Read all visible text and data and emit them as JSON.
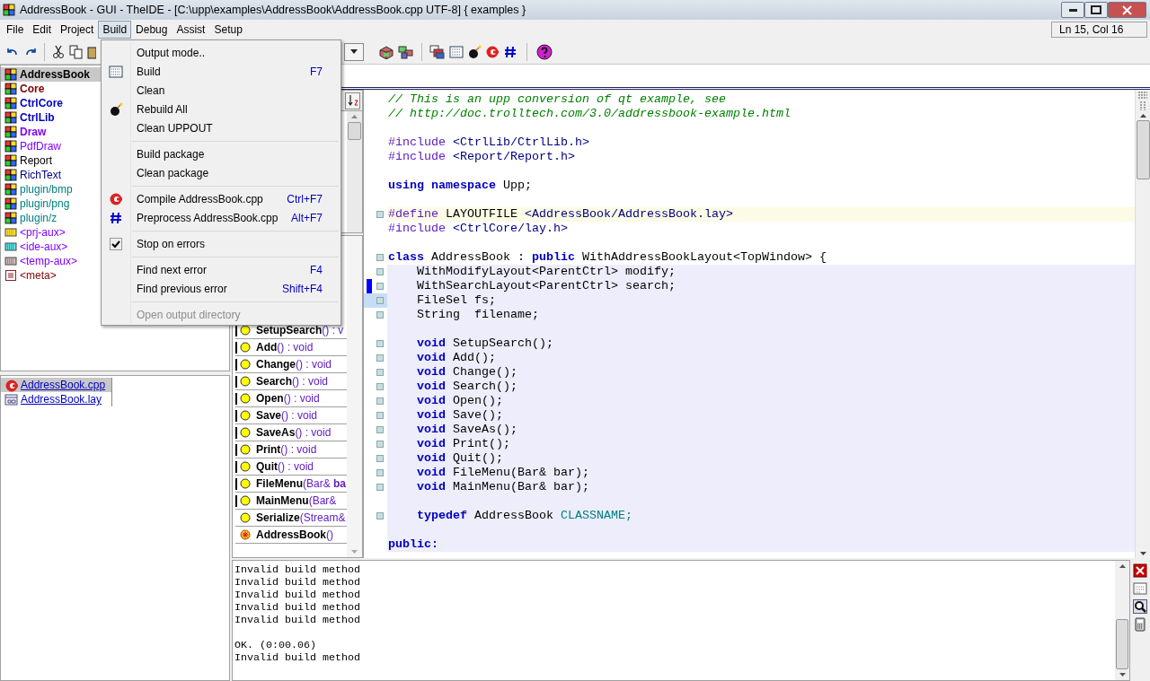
{
  "window": {
    "title": "AddressBook - GUI - TheIDE - [C:\\upp\\examples\\AddressBook\\AddressBook.cpp UTF-8] { examples }"
  },
  "menu_bar": [
    {
      "label": "File",
      "selected": false
    },
    {
      "label": "Edit",
      "selected": false
    },
    {
      "label": "Project",
      "selected": false
    },
    {
      "label": "Build",
      "selected": true
    },
    {
      "label": "Debug",
      "selected": false
    },
    {
      "label": "Assist",
      "selected": false
    },
    {
      "label": "Setup",
      "selected": false
    }
  ],
  "position": "Ln 15, Col 16",
  "build_menu": [
    {
      "kind": "item",
      "label": "Output mode..",
      "disabled": false
    },
    {
      "kind": "item",
      "label": "Build",
      "shortcut": "F7",
      "disabled": false
    },
    {
      "kind": "item",
      "label": "Clean",
      "disabled": false
    },
    {
      "kind": "item",
      "label": "Rebuild All",
      "disabled": false
    },
    {
      "kind": "item",
      "label": "Clean UPPOUT",
      "disabled": false
    },
    {
      "kind": "separator"
    },
    {
      "kind": "item",
      "label": "Build package",
      "disabled": false
    },
    {
      "kind": "item",
      "label": "Clean package",
      "disabled": false
    },
    {
      "kind": "separator"
    },
    {
      "kind": "item",
      "label": "Compile AddressBook.cpp",
      "shortcut": "Ctrl+F7",
      "disabled": false
    },
    {
      "kind": "item",
      "label": "Preprocess AddressBook.cpp",
      "shortcut": "Alt+F7",
      "disabled": false
    },
    {
      "kind": "separator"
    },
    {
      "kind": "item",
      "label": "Stop on errors",
      "checked": true,
      "disabled": false
    },
    {
      "kind": "separator"
    },
    {
      "kind": "item",
      "label": "Find next error",
      "shortcut": "F4",
      "disabled": false
    },
    {
      "kind": "item",
      "label": "Find previous error",
      "shortcut": "Shift+F4",
      "disabled": false
    },
    {
      "kind": "separator"
    },
    {
      "kind": "item",
      "label": "Open output directory",
      "disabled": true
    }
  ],
  "packages": [
    {
      "name": "AddressBook",
      "kind": "package",
      "color": "#000000",
      "bold": true,
      "selected": true
    },
    {
      "name": "Core",
      "kind": "package",
      "color": "#800000",
      "bold": true,
      "selected": false
    },
    {
      "name": "CtrlCore",
      "kind": "package",
      "color": "#0000c0",
      "bold": true,
      "selected": false
    },
    {
      "name": "CtrlLib",
      "kind": "package",
      "color": "#0000c0",
      "bold": true,
      "selected": false
    },
    {
      "name": "Draw",
      "kind": "package",
      "color": "#8000ff",
      "bold": true,
      "selected": false
    },
    {
      "name": "PdfDraw",
      "kind": "package",
      "color": "#8000ff",
      "bold": false,
      "selected": false
    },
    {
      "name": "Report",
      "kind": "package",
      "color": "#000000",
      "bold": false,
      "selected": false
    },
    {
      "name": "RichText",
      "kind": "package",
      "color": "#000080",
      "bold": false,
      "selected": false
    },
    {
      "name": "plugin/bmp",
      "kind": "package",
      "color": "#008080",
      "bold": false,
      "selected": false
    },
    {
      "name": "plugin/png",
      "kind": "package",
      "color": "#008080",
      "bold": false,
      "selected": false
    },
    {
      "name": "plugin/z",
      "kind": "package",
      "color": "#008080",
      "bold": false,
      "selected": false
    },
    {
      "name": "<prj-aux>",
      "kind": "aux-yellow",
      "color": "#8000ff",
      "bold": false,
      "selected": false
    },
    {
      "name": "<ide-aux>",
      "kind": "aux-cyan",
      "color": "#8000ff",
      "bold": false,
      "selected": false
    },
    {
      "name": "<temp-aux>",
      "kind": "aux-gray",
      "color": "#8000ff",
      "bold": false,
      "selected": false
    },
    {
      "name": "<meta>",
      "kind": "meta",
      "color": "#800000",
      "bold": false,
      "selected": false
    }
  ],
  "files": [
    {
      "name": "AddressBook.cpp",
      "kind": "cpp",
      "selected": true
    },
    {
      "name": "AddressBook.lay",
      "kind": "layout",
      "selected": false
    }
  ],
  "navigator": [
    {
      "name": "SetupSearch",
      "rest": "() : v",
      "marked": true,
      "kind": "method"
    },
    {
      "name": "Add",
      "rest": "() : void",
      "marked": true,
      "kind": "method"
    },
    {
      "name": "Change",
      "rest": "() : void",
      "marked": true,
      "kind": "method"
    },
    {
      "name": "Search",
      "rest": "() : void",
      "marked": true,
      "kind": "method"
    },
    {
      "name": "Open",
      "rest": "() : void",
      "marked": true,
      "kind": "method"
    },
    {
      "name": "Save",
      "rest": "() : void",
      "marked": true,
      "kind": "method"
    },
    {
      "name": "SaveAs",
      "rest": "() : void",
      "marked": true,
      "kind": "method"
    },
    {
      "name": "Print",
      "rest": "() : void",
      "marked": true,
      "kind": "method"
    },
    {
      "name": "Quit",
      "rest": "() : void",
      "marked": true,
      "kind": "method"
    },
    {
      "name": "FileMenu",
      "rest": "(Bar& **ba**",
      "marked": true,
      "kind": "method"
    },
    {
      "name": "MainMenu",
      "rest": "(Bar&",
      "marked": true,
      "kind": "method"
    },
    {
      "name": "Serialize",
      "rest": "(Stream&",
      "marked": false,
      "kind": "method"
    },
    {
      "name": "AddressBook",
      "rest": "()",
      "marked": false,
      "kind": "constructor"
    }
  ],
  "code": [
    {
      "kind": "code",
      "tokens": [
        {
          "kind": "comment",
          "text": "// This is an upp conversion of qt example, see"
        }
      ]
    },
    {
      "kind": "code",
      "tokens": [
        {
          "kind": "comment",
          "text": "// http://doc.trolltech.com/3.0/addressbook-example.html"
        }
      ]
    },
    {
      "kind": "blank"
    },
    {
      "kind": "code",
      "tokens": [
        {
          "kind": "preproc",
          "text": "#include"
        },
        {
          "kind": "header",
          "text": "<CtrlLib/CtrlLib.h>"
        }
      ]
    },
    {
      "kind": "code",
      "tokens": [
        {
          "kind": "preproc",
          "text": "#include"
        },
        {
          "kind": "header",
          "text": "<Report/Report.h>"
        }
      ]
    },
    {
      "kind": "blank"
    },
    {
      "kind": "code",
      "tokens": [
        {
          "kind": "keyword",
          "text": "using namespace"
        },
        {
          "kind": "plain",
          "text": "Upp;"
        }
      ]
    },
    {
      "kind": "blank"
    },
    {
      "kind": "code",
      "tokens": [
        {
          "kind": "preproc",
          "text": "#define"
        },
        {
          "kind": "plain",
          "text": "LAYOUTFILE"
        },
        {
          "kind": "header",
          "text": "<AddressBook/AddressBook.lay>"
        }
      ],
      "marker": true,
      "highlighted": true
    },
    {
      "kind": "code",
      "tokens": [
        {
          "kind": "preproc",
          "text": "#include"
        },
        {
          "kind": "header",
          "text": "<CtrlCore/lay.h>"
        }
      ]
    },
    {
      "kind": "blank"
    },
    {
      "kind": "code",
      "tokens": [
        {
          "kind": "keyword",
          "text": "class"
        },
        {
          "kind": "plain",
          "text": "AddressBook :"
        },
        {
          "kind": "keyword",
          "text": "public"
        },
        {
          "kind": "plain",
          "text": "WithAddressBookLayout<TopWindow> {"
        }
      ],
      "marker": true
    },
    {
      "kind": "code",
      "indent": true,
      "tokens": [
        {
          "kind": "plain",
          "text": "WithModifyLayout<ParentCtrl> modify;"
        }
      ],
      "marker": true,
      "shaded": true
    },
    {
      "kind": "code",
      "indent": true,
      "tokens": [
        {
          "kind": "plain",
          "text": "WithSearchLayout<ParentCtrl> search;"
        }
      ],
      "marker": true,
      "changed": true,
      "shaded": true
    },
    {
      "kind": "code",
      "indent": true,
      "tokens": [
        {
          "kind": "plain",
          "text": "FileSel fs;"
        }
      ],
      "marker": true,
      "current": true,
      "shaded": true
    },
    {
      "kind": "code",
      "indent": true,
      "tokens": [
        {
          "kind": "plain",
          "text": "String  filename;"
        }
      ],
      "marker": true,
      "shaded": true
    },
    {
      "kind": "blank",
      "shaded": true
    },
    {
      "kind": "code",
      "indent": true,
      "tokens": [
        {
          "kind": "keyword",
          "text": "void"
        },
        {
          "kind": "plain",
          "text": "SetupSearch();"
        }
      ],
      "marker": true,
      "shaded": true
    },
    {
      "kind": "code",
      "indent": true,
      "tokens": [
        {
          "kind": "keyword",
          "text": "void"
        },
        {
          "kind": "plain",
          "text": "Add();"
        }
      ],
      "marker": true,
      "shaded": true
    },
    {
      "kind": "code",
      "indent": true,
      "tokens": [
        {
          "kind": "keyword",
          "text": "void"
        },
        {
          "kind": "plain",
          "text": "Change();"
        }
      ],
      "marker": true,
      "shaded": true
    },
    {
      "kind": "code",
      "indent": true,
      "tokens": [
        {
          "kind": "keyword",
          "text": "void"
        },
        {
          "kind": "plain",
          "text": "Search();"
        }
      ],
      "marker": true,
      "shaded": true
    },
    {
      "kind": "code",
      "indent": true,
      "tokens": [
        {
          "kind": "keyword",
          "text": "void"
        },
        {
          "kind": "plain",
          "text": "Open();"
        }
      ],
      "marker": true,
      "shaded": true
    },
    {
      "kind": "code",
      "indent": true,
      "tokens": [
        {
          "kind": "keyword",
          "text": "void"
        },
        {
          "kind": "plain",
          "text": "Save();"
        }
      ],
      "marker": true,
      "shaded": true
    },
    {
      "kind": "code",
      "indent": true,
      "tokens": [
        {
          "kind": "keyword",
          "text": "void"
        },
        {
          "kind": "plain",
          "text": "SaveAs();"
        }
      ],
      "marker": true,
      "shaded": true
    },
    {
      "kind": "code",
      "indent": true,
      "tokens": [
        {
          "kind": "keyword",
          "text": "void"
        },
        {
          "kind": "plain",
          "text": "Print();"
        }
      ],
      "marker": true,
      "shaded": true
    },
    {
      "kind": "code",
      "indent": true,
      "tokens": [
        {
          "kind": "keyword",
          "text": "void"
        },
        {
          "kind": "plain",
          "text": "Quit();"
        }
      ],
      "marker": true,
      "shaded": true
    },
    {
      "kind": "code",
      "indent": true,
      "tokens": [
        {
          "kind": "keyword",
          "text": "void"
        },
        {
          "kind": "plain",
          "text": "FileMenu(Bar& bar);"
        }
      ],
      "marker": true,
      "shaded": true
    },
    {
      "kind": "code",
      "indent": true,
      "tokens": [
        {
          "kind": "keyword",
          "text": "void"
        },
        {
          "kind": "plain",
          "text": "MainMenu(Bar& bar);"
        }
      ],
      "marker": true,
      "shaded": true
    },
    {
      "kind": "blank",
      "shaded": true
    },
    {
      "kind": "code",
      "indent": true,
      "tokens": [
        {
          "kind": "keyword",
          "text": "typedef"
        },
        {
          "kind": "plain",
          "text": "AddressBook"
        },
        {
          "kind": "constant",
          "text": "CLASSNAME;"
        }
      ],
      "marker": true,
      "shaded": true
    },
    {
      "kind": "blank",
      "shaded": true
    },
    {
      "kind": "code",
      "tokens": [
        {
          "kind": "keyword",
          "text": "public:"
        }
      ],
      "shaded": true
    }
  ],
  "output": [
    {
      "kind": "text",
      "text": "Invalid build method"
    },
    {
      "kind": "text",
      "text": "Invalid build method"
    },
    {
      "kind": "text",
      "text": "Invalid build method"
    },
    {
      "kind": "text",
      "text": "Invalid build method"
    },
    {
      "kind": "text",
      "text": "Invalid build method"
    },
    {
      "kind": "blank"
    },
    {
      "kind": "text",
      "text": "OK. (0:00.06)"
    },
    {
      "kind": "text",
      "text": "Invalid build method"
    }
  ]
}
